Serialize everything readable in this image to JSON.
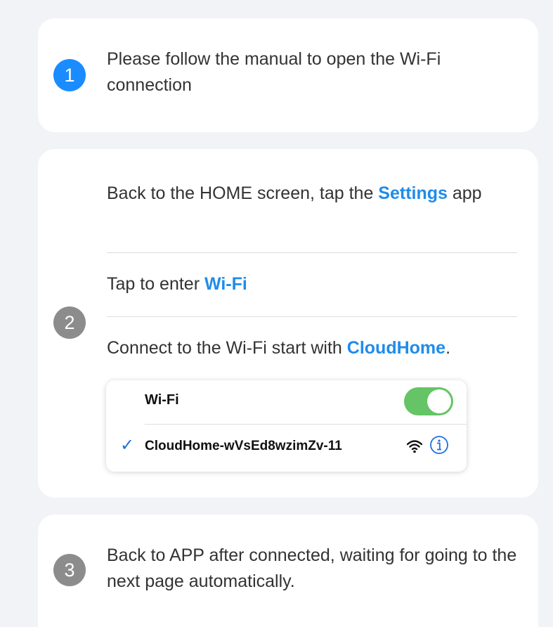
{
  "steps": [
    {
      "number": "1",
      "text": "Please follow the manual to open the Wi-Fi connection"
    },
    {
      "number": "2",
      "sub_steps": [
        {
          "before": "Back to the HOME screen, tap the ",
          "highlight": "Settings",
          "after": " app"
        },
        {
          "before": "Tap to enter ",
          "highlight": "Wi-Fi",
          "after": ""
        },
        {
          "before": "Connect to the Wi-Fi start with ",
          "highlight": "CloudHome",
          "after": "."
        }
      ],
      "wifi_panel": {
        "label": "Wi-Fi",
        "toggle_on": true,
        "check_mark": "✓",
        "network_name": "CloudHome-wVsEd8wzimZv-11",
        "signal_icon": "wifi-signal-icon",
        "info_icon": "info-icon"
      }
    },
    {
      "number": "3",
      "text": "Back to APP after connected, waiting for going to the next page automatically."
    }
  ],
  "colors": {
    "active_badge": "#1a8cff",
    "inactive_badge": "#8c8c8c",
    "highlight": "#1f8ceb",
    "toggle_on": "#65c466",
    "background": "#f2f3f7"
  }
}
